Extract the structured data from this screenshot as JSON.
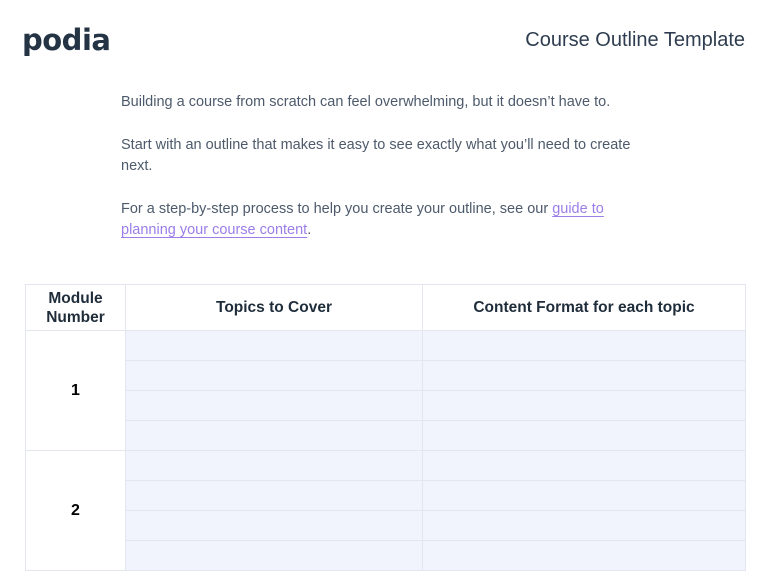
{
  "header": {
    "logo": "podia",
    "title": "Course Outline Template"
  },
  "intro": {
    "p1": "Building a course from scratch can feel overwhelming, but it doesn’t have to.",
    "p2": "Start with an outline that makes it easy to see exactly what you’ll need to create next.",
    "p3_prefix": "For a step-by-step process to help you create your outline, see our ",
    "p3_link": "guide to planning your course content",
    "p3_suffix": "."
  },
  "table": {
    "headers": {
      "module": "Module Number",
      "topics": "Topics to Cover",
      "format": "Content Format for each topic"
    },
    "modules": [
      {
        "number": "1"
      },
      {
        "number": "2"
      }
    ]
  }
}
